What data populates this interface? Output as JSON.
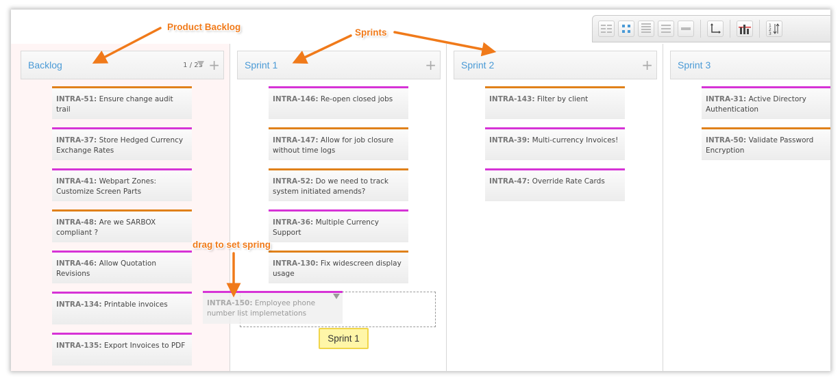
{
  "annotations": {
    "product_backlog": "Product Backlog",
    "sprints": "Sprints",
    "drag_hint": "drag to set spring"
  },
  "toolbar": {
    "buttons": [
      "list-view-icon",
      "grid-view-icon",
      "rows-view-icon",
      "lines-view-icon",
      "collapse-view-icon",
      "axis-icon",
      "bar-chart-icon",
      "sort-icon"
    ]
  },
  "columns": [
    {
      "title": "Backlog",
      "count": "1 / 23",
      "cards": [
        {
          "key": "INTRA-51:",
          "text": "Ensure change audit trail",
          "color": "#e0811a"
        },
        {
          "key": "INTRA-37:",
          "text": "Store Hedged Currency Exchange Rates",
          "color": "#d633d6"
        },
        {
          "key": "INTRA-41:",
          "text": "Webpart Zones: Customize Screen Parts",
          "color": "#d633d6"
        },
        {
          "key": "INTRA-48:",
          "text": "Are we SARBOX compliant ?",
          "color": "#e0811a"
        },
        {
          "key": "INTRA-46:",
          "text": "Allow Quotation Revisions",
          "color": "#d633d6"
        },
        {
          "key": "INTRA-134:",
          "text": "Printable invoices",
          "color": "#d633d6"
        },
        {
          "key": "INTRA-135:",
          "text": "Export Invoices to PDF",
          "color": "#d633d6"
        }
      ]
    },
    {
      "title": "Sprint 1",
      "cards": [
        {
          "key": "INTRA-146:",
          "text": "Re-open closed jobs",
          "color": "#d633d6"
        },
        {
          "key": "INTRA-147:",
          "text": "Allow for job closure without time logs",
          "color": "#e0811a"
        },
        {
          "key": "INTRA-52:",
          "text": "Do we need to track system initiated amends?",
          "color": "#e0811a"
        },
        {
          "key": "INTRA-36:",
          "text": "Multiple Currency Support",
          "color": "#d633d6"
        },
        {
          "key": "INTRA-130:",
          "text": "Fix widescreen display usage",
          "color": "#e0811a"
        }
      ]
    },
    {
      "title": "Sprint 2",
      "cards": [
        {
          "key": "INTRA-143:",
          "text": "Filter by client",
          "color": "#e0811a"
        },
        {
          "key": "INTRA-39:",
          "text": "Multi-currency Invoices!",
          "color": "#d633d6"
        },
        {
          "key": "INTRA-47:",
          "text": "Override Rate Cards",
          "color": "#d633d6"
        }
      ]
    },
    {
      "title": "Sprint 3",
      "cards": [
        {
          "key": "INTRA-31:",
          "text": "Active Directory Authentication",
          "color": "#d633d6"
        },
        {
          "key": "INTRA-50:",
          "text": "Validate Password Encryption",
          "color": "#e0811a"
        }
      ]
    }
  ],
  "drag": {
    "card_key": "INTRA-150:",
    "card_text": "Employee phone number list implemetations",
    "target_label": "Sprint 1"
  }
}
